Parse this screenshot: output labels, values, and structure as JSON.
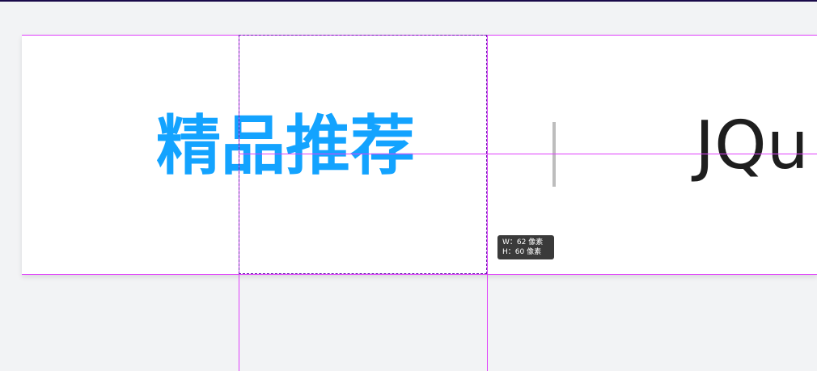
{
  "content": {
    "featured_title": "精品推荐",
    "jq_text": "JQu"
  },
  "measure_tooltip": {
    "width_line": "W：62 像素",
    "height_line": "H：60 像素"
  },
  "colors": {
    "title": "#13a3ff",
    "guide": "#e040fb",
    "selection": "#6a1fb0"
  }
}
